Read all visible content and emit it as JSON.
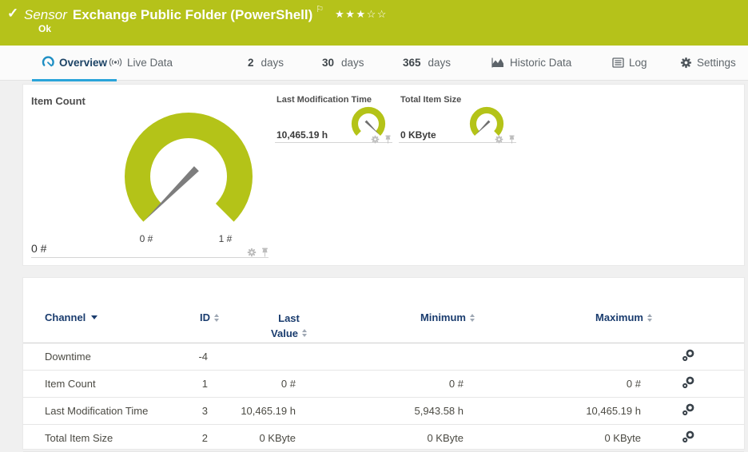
{
  "header": {
    "status_icon": "✓",
    "kind": "Sensor",
    "title": "Exchange Public Folder (PowerShell)",
    "flag_icon": "⚐",
    "stars": "★★★☆☆",
    "status": "Ok",
    "color": "#b5c21a"
  },
  "tabs": [
    {
      "label": "Overview",
      "active": true
    },
    {
      "label": "Live Data"
    },
    {
      "num": "2",
      "label": "days"
    },
    {
      "num": "30",
      "label": "days"
    },
    {
      "num": "365",
      "label": "days"
    },
    {
      "label": "Historic Data"
    },
    {
      "label": "Log"
    },
    {
      "label": "Settings"
    }
  ],
  "icons": {
    "overview": "gauge-icon",
    "live_data": "broadcast-icon",
    "historic_data": "area-chart-icon",
    "log": "list-icon",
    "settings": "gear-icon",
    "footer": [
      "gear-icon",
      "pin-icon"
    ],
    "row_action": "channel-settings-gears-icon"
  },
  "colors": {
    "status_green": "#b5c21a",
    "gauge_green": "#b4c318",
    "active_tab_blue": "#2aa4da",
    "header_navy": "#1a3c6e",
    "needle_gray": "#7d7d7d"
  },
  "gauges": {
    "primary": {
      "title": "Item Count",
      "value": "0 #",
      "min_label": "0 #",
      "max_label": "1 #"
    },
    "secondary": [
      {
        "title": "Last Modification Time",
        "value": "10,465.19 h"
      },
      {
        "title": "Total Item Size",
        "value": "0 KByte"
      }
    ]
  },
  "table": {
    "col_channel": "Channel",
    "col_id": "ID",
    "col_last_line1": "Last",
    "col_last_line2": "Value",
    "col_min": "Minimum",
    "col_max": "Maximum",
    "rows": [
      {
        "channel": "Downtime",
        "id": "-4",
        "last": "",
        "min": "",
        "max": ""
      },
      {
        "channel": "Item Count",
        "id": "1",
        "last": "0 #",
        "min": "0 #",
        "max": "0 #"
      },
      {
        "channel": "Last Modification Time",
        "id": "3",
        "last": "10,465.19 h",
        "min": "5,943.58 h",
        "max": "10,465.19 h"
      },
      {
        "channel": "Total Item Size",
        "id": "2",
        "last": "0 KByte",
        "min": "0 KByte",
        "max": "0 KByte"
      }
    ]
  }
}
